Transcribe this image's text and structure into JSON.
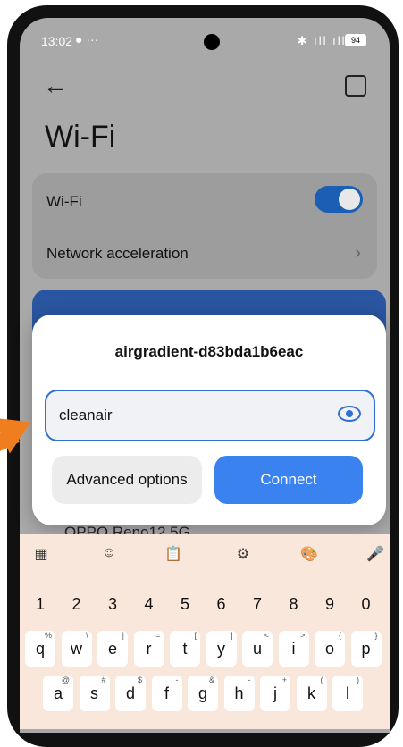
{
  "status": {
    "time": "13:02",
    "extra": "● ···",
    "battery": "94"
  },
  "header": {
    "title": "Wi-Fi"
  },
  "settings": {
    "wifi_label": "Wi-Fi",
    "accel_label": "Network acceleration"
  },
  "list": {
    "network_below": "OPPO Reno12 5G"
  },
  "dialog": {
    "ssid": "airgradient-d83bda1b6eac",
    "password_value": "cleanair",
    "advanced_label": "Advanced options",
    "connect_label": "Connect"
  },
  "keyboard": {
    "numbers": [
      "1",
      "2",
      "3",
      "4",
      "5",
      "6",
      "7",
      "8",
      "9",
      "0"
    ],
    "row1": [
      [
        "q",
        "%"
      ],
      [
        "w",
        "\\"
      ],
      [
        "e",
        "|"
      ],
      [
        "r",
        "="
      ],
      [
        "t",
        "["
      ],
      [
        "y",
        "]"
      ],
      [
        "u",
        "<"
      ],
      [
        "i",
        ">"
      ],
      [
        "o",
        "{"
      ],
      [
        "p",
        "}"
      ]
    ],
    "row2": [
      [
        "a",
        "@"
      ],
      [
        "s",
        "#"
      ],
      [
        "d",
        "$"
      ],
      [
        "f",
        "-"
      ],
      [
        "g",
        "&"
      ],
      [
        "h",
        "-"
      ],
      [
        "j",
        "+"
      ],
      [
        "k",
        "("
      ],
      [
        "l",
        ")"
      ]
    ]
  },
  "colors": {
    "accent": "#3a82f0",
    "toggle": "#1a5fb4",
    "keyboard_bg": "#f8e7da",
    "arrow": "#f07d1e"
  }
}
